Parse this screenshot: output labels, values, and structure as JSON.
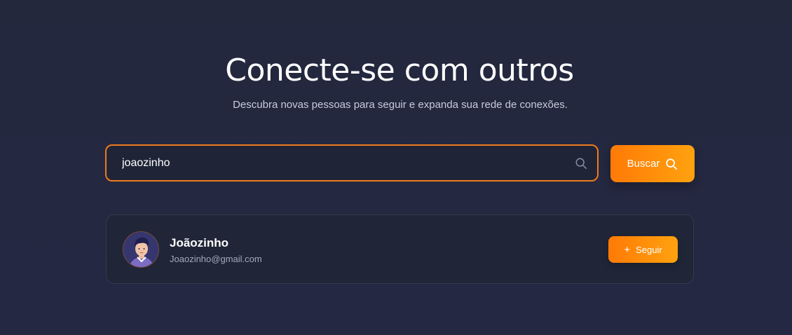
{
  "header": {
    "title": "Conecte-se com outros",
    "subtitle": "Descubra novas pessoas para seguir e expanda sua rede de conexões."
  },
  "search": {
    "value": "joaozinho",
    "placeholder": "",
    "button_label": "Buscar"
  },
  "results": [
    {
      "name": "Joãozinho",
      "email": "Joaozinho@gmail.com",
      "follow_label": "Seguir",
      "follow_icon": "plus"
    }
  ],
  "colors": {
    "background": "#23283d",
    "accent": "#ff7a06",
    "accent_end": "#ffa20f",
    "input_border": "#f07a1c",
    "card_bg": "#202637"
  }
}
